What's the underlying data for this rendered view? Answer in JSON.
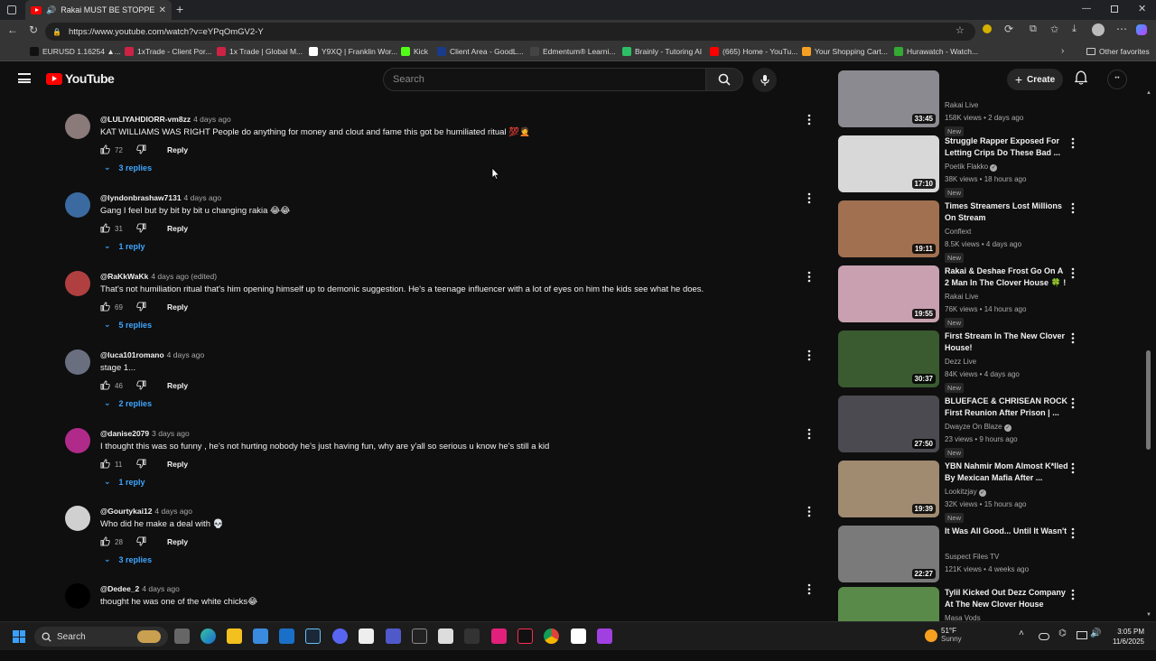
{
  "browser": {
    "tab_title": "Rakai MUST BE STOPPED... -",
    "url": "https://www.youtube.com/watch?v=eYPqOmGV2-Y",
    "bookmarks": [
      {
        "label": "EURUSD 1.16254 ▲...",
        "color": "#111111"
      },
      {
        "label": "1xTrade - Client Por...",
        "color": "#cc2244"
      },
      {
        "label": "1x Trade | Global M...",
        "color": "#cc2244"
      },
      {
        "label": "Y9XQ | Franklin Wor...",
        "color": "#ffffff"
      },
      {
        "label": "Kick",
        "color": "#53fc18"
      },
      {
        "label": "Client Area - GoodL...",
        "color": "#1a3b8a"
      },
      {
        "label": "Edmentum® Learni...",
        "color": "#444444"
      },
      {
        "label": "Brainly - Tutoring AI",
        "color": "#2dbf65"
      },
      {
        "label": "(665) Home - YouTu...",
        "color": "#ff0000"
      },
      {
        "label": "Your Shopping Cart...",
        "color": "#f6a023"
      },
      {
        "label": "Hurawatch - Watch...",
        "color": "#33aa33"
      }
    ],
    "other_favorites": "Other favorites"
  },
  "youtube": {
    "logo_text": "YouTube",
    "search_placeholder": "Search",
    "create_label": "Create"
  },
  "comments": [
    {
      "user": "@LULIYAHDIORR-vm8zz",
      "time": "4 days ago",
      "text": "KAT WILLIAMS WAS RIGHT People do anything for money and clout and fame this got be humiliated ritual 💯🤦",
      "likes": "72",
      "reply": "Reply",
      "replies": "3 replies",
      "avatar": "#8a7a7a"
    },
    {
      "user": "@lyndonbrashaw7131",
      "time": "4 days ago",
      "text": "Gang I feel but by bit by bit u changing rakia 😂😂",
      "likes": "31",
      "reply": "Reply",
      "replies": "1 reply",
      "avatar": "#3a6aa0"
    },
    {
      "user": "@RaKkWaKk",
      "time": "4 days ago (edited)",
      "text": "That's not humiliation ritual that's him opening himself up to demonic suggestion. He's a teenage influencer with a lot of eyes on him the kids see what he does.",
      "likes": "69",
      "reply": "Reply",
      "replies": "5 replies",
      "avatar": "#b04040"
    },
    {
      "user": "@luca101romano",
      "time": "4 days ago",
      "text": "stage 1...",
      "likes": "46",
      "reply": "Reply",
      "replies": "2 replies",
      "avatar": "#6a6f80"
    },
    {
      "user": "@danise2079",
      "time": "3 days ago",
      "text": "I thought this was so funny , he's not hurting nobody he's just having fun, why are y'all so serious u know he's still a kid",
      "likes": "11",
      "reply": "Reply",
      "replies": "1 reply",
      "avatar": "#b02a8a"
    },
    {
      "user": "@Gourtykai12",
      "time": "4 days ago",
      "text": "Who did he make a deal with 💀",
      "likes": "28",
      "reply": "Reply",
      "replies": "3 replies",
      "avatar": "#d0d0d0"
    },
    {
      "user": "@Dedee_2",
      "time": "4 days ago",
      "text": "thought he was one of the white chicks😂",
      "likes": "",
      "reply": "",
      "replies": "",
      "avatar": "#000000"
    }
  ],
  "videos": [
    {
      "title": "",
      "channel": "Rakai Live",
      "meta": "158K views • 2 days ago",
      "badge": "New",
      "duration": "33:45",
      "thumb": "#8a8a90",
      "verified": false
    },
    {
      "title": "Struggle Rapper Exposed For Letting Crips Do These Bad ...",
      "channel": "Poetik Flakko",
      "meta": "38K views • 18 hours ago",
      "badge": "New",
      "duration": "17:10",
      "thumb": "#d8d8d8",
      "verified": true
    },
    {
      "title": "Times Streamers Lost Millions On Stream",
      "channel": "Conflext",
      "meta": "8.5K views • 4 days ago",
      "badge": "New",
      "duration": "19:11",
      "thumb": "#a07050",
      "verified": false
    },
    {
      "title": "Rakai & Deshae Frost Go On A 2 Man In The Clover House 🍀 !",
      "channel": "Rakai Live",
      "meta": "76K views • 14 hours ago",
      "badge": "New",
      "duration": "19:55",
      "thumb": "#c9a0b0",
      "verified": false
    },
    {
      "title": "First Stream In The New Clover House!",
      "channel": "Dezz Live",
      "meta": "84K views • 4 days ago",
      "badge": "New",
      "duration": "30:37",
      "thumb": "#3a5a30",
      "verified": false
    },
    {
      "title": "BLUEFACE & CHRISEAN ROCK First Reunion After Prison | ...",
      "channel": "Dwayze On Blaze",
      "meta": "23 views • 9 hours ago",
      "badge": "New",
      "duration": "27:50",
      "thumb": "#4a4a50",
      "verified": true
    },
    {
      "title": "YBN Nahmir Mom Almost K*lled By Mexican Mafia After ...",
      "channel": "Lookitzjay",
      "meta": "32K views • 15 hours ago",
      "badge": "New",
      "duration": "19:39",
      "thumb": "#a08a70",
      "verified": true
    },
    {
      "title": "It Was All Good... Until It Wasn't",
      "channel": "Suspect Files TV",
      "meta": "121K views • 4 weeks ago",
      "badge": "",
      "duration": "22:27",
      "thumb": "#7a7a7a",
      "verified": false
    },
    {
      "title": "Tylil Kicked Out Dezz Company At The New Clover House",
      "channel": "Masa Vods",
      "meta": "",
      "badge": "",
      "duration": "",
      "thumb": "#5a8a4a",
      "verified": false
    }
  ],
  "taskbar": {
    "search_label": "Search",
    "temp": "51°F",
    "weather": "Sunny",
    "time": "3:05 PM",
    "date": "11/6/2025"
  }
}
